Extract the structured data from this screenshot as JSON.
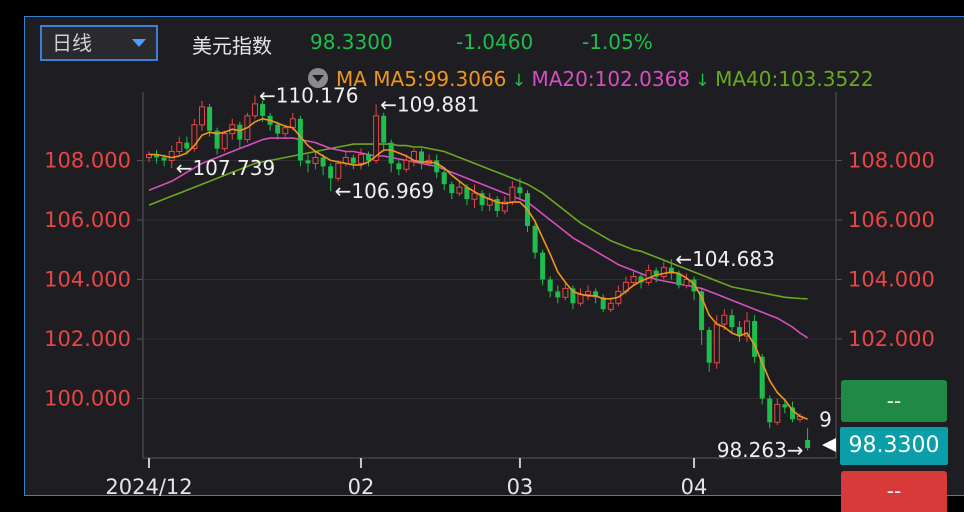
{
  "header": {
    "period": "日线",
    "name": "美元指数",
    "price": "98.3300",
    "change": "-1.0460",
    "change_pct": "-1.05%",
    "ma_label": "MA",
    "ma5": "MA5:99.3066",
    "ma20": "MA20:102.0368",
    "ma40": "MA40:103.3522"
  },
  "side": {
    "buy_label": "--",
    "current_price": "98.3300",
    "sell_label": "--"
  },
  "colors": {
    "up": "#e84545",
    "down": "#1fbd4e",
    "ma5": "#f0951e",
    "ma20": "#d64fc0",
    "ma40": "#6aa820",
    "axis_text": "#e84545",
    "up_text": "#1fbd4e"
  },
  "chart_data": {
    "type": "candlestick",
    "ylim": [
      98.0,
      110.3
    ],
    "yticks": [
      "100.000",
      "102.000",
      "104.000",
      "106.000",
      "108.000"
    ],
    "ytick_values": [
      100,
      102,
      104,
      106,
      108
    ],
    "xticks": [
      "2024/12",
      "02",
      "03",
      "04"
    ],
    "xtick_index": [
      0,
      28,
      49,
      72
    ],
    "annotations": [
      {
        "text": "←110.176",
        "index": 14,
        "value": 110.176
      },
      {
        "text": "←109.881",
        "index": 30,
        "value": 109.881
      },
      {
        "text": "←107.739",
        "index": 3,
        "value": 107.739
      },
      {
        "text": "←106.969",
        "index": 24,
        "value": 106.969
      },
      {
        "text": "←104.683",
        "index": 69,
        "value": 104.683
      },
      {
        "text": "98.263→",
        "index": 87,
        "value": 98.263
      },
      {
        "text": "9",
        "index": 88,
        "value": 99.3
      }
    ],
    "candles": [
      [
        108.1,
        108.2,
        107.95,
        108.3
      ],
      [
        108.2,
        108.1,
        107.9,
        108.35
      ],
      [
        108.1,
        108.0,
        107.8,
        108.2
      ],
      [
        108.0,
        108.3,
        107.74,
        108.5
      ],
      [
        108.3,
        108.6,
        108.2,
        108.8
      ],
      [
        108.6,
        108.4,
        108.2,
        108.8
      ],
      [
        108.4,
        109.2,
        108.3,
        109.4
      ],
      [
        109.2,
        109.8,
        109.0,
        110.0
      ],
      [
        109.8,
        109.0,
        108.8,
        109.9
      ],
      [
        109.0,
        108.4,
        108.2,
        109.1
      ],
      [
        108.4,
        108.9,
        108.3,
        109.0
      ],
      [
        108.9,
        109.2,
        108.7,
        109.4
      ],
      [
        109.2,
        108.7,
        108.4,
        109.3
      ],
      [
        108.7,
        109.5,
        108.6,
        109.6
      ],
      [
        109.5,
        109.9,
        109.4,
        110.18
      ],
      [
        109.9,
        109.5,
        109.3,
        110.0
      ],
      [
        109.5,
        109.2,
        109.0,
        109.6
      ],
      [
        109.2,
        108.9,
        108.7,
        109.3
      ],
      [
        108.9,
        109.1,
        108.8,
        109.2
      ],
      [
        109.1,
        109.4,
        109.0,
        109.6
      ],
      [
        109.4,
        108.0,
        107.8,
        109.5
      ],
      [
        108.0,
        107.9,
        107.6,
        108.2
      ],
      [
        107.9,
        108.1,
        107.7,
        108.3
      ],
      [
        108.1,
        107.8,
        107.5,
        108.2
      ],
      [
        107.8,
        107.4,
        106.97,
        107.9
      ],
      [
        107.4,
        107.9,
        107.3,
        108.0
      ],
      [
        107.9,
        108.1,
        107.8,
        108.3
      ],
      [
        108.1,
        107.9,
        107.7,
        108.2
      ],
      [
        107.9,
        108.2,
        107.7,
        108.4
      ],
      [
        108.2,
        108.0,
        107.8,
        108.3
      ],
      [
        108.0,
        109.5,
        107.9,
        109.88
      ],
      [
        109.5,
        108.6,
        108.3,
        109.6
      ],
      [
        108.6,
        107.9,
        107.6,
        108.7
      ],
      [
        107.9,
        107.7,
        107.5,
        108.0
      ],
      [
        107.7,
        108.0,
        107.6,
        108.2
      ],
      [
        108.0,
        108.3,
        107.8,
        108.4
      ],
      [
        108.3,
        107.9,
        107.7,
        108.4
      ],
      [
        107.9,
        108.0,
        107.8,
        108.2
      ],
      [
        108.0,
        107.6,
        107.4,
        108.2
      ],
      [
        107.6,
        107.2,
        107.0,
        107.7
      ],
      [
        107.2,
        106.9,
        106.7,
        107.3
      ],
      [
        106.9,
        107.1,
        106.8,
        107.3
      ],
      [
        107.1,
        106.7,
        106.5,
        107.2
      ],
      [
        106.7,
        106.9,
        106.4,
        107.2
      ],
      [
        106.9,
        106.5,
        106.3,
        107.0
      ],
      [
        106.5,
        106.7,
        106.3,
        106.9
      ],
      [
        106.7,
        106.3,
        106.1,
        106.8
      ],
      [
        106.3,
        106.6,
        106.2,
        106.8
      ],
      [
        106.6,
        107.1,
        106.5,
        107.3
      ],
      [
        107.1,
        106.9,
        106.7,
        107.4
      ],
      [
        106.9,
        105.8,
        105.6,
        107.0
      ],
      [
        105.8,
        104.9,
        104.7,
        105.9
      ],
      [
        104.9,
        104.0,
        103.8,
        105.0
      ],
      [
        104.0,
        103.6,
        103.4,
        104.1
      ],
      [
        103.6,
        103.4,
        103.2,
        103.8
      ],
      [
        103.4,
        103.7,
        103.3,
        103.9
      ],
      [
        103.7,
        103.2,
        103.0,
        103.8
      ],
      [
        103.2,
        103.5,
        103.1,
        103.7
      ],
      [
        103.5,
        103.6,
        103.3,
        103.8
      ],
      [
        103.6,
        103.4,
        103.2,
        103.7
      ],
      [
        103.4,
        103.0,
        102.9,
        103.5
      ],
      [
        103.0,
        103.2,
        102.9,
        103.4
      ],
      [
        103.2,
        103.6,
        103.1,
        103.8
      ],
      [
        103.6,
        103.9,
        103.5,
        104.1
      ],
      [
        103.9,
        104.1,
        103.8,
        104.3
      ],
      [
        104.1,
        103.9,
        103.7,
        104.2
      ],
      [
        103.9,
        104.3,
        103.8,
        104.5
      ],
      [
        104.3,
        104.1,
        103.9,
        104.4
      ],
      [
        104.1,
        104.4,
        104.0,
        104.6
      ],
      [
        104.4,
        104.2,
        104.0,
        104.68
      ],
      [
        104.2,
        103.8,
        103.7,
        104.3
      ],
      [
        103.8,
        104.0,
        103.7,
        104.2
      ],
      [
        104.0,
        103.6,
        103.3,
        104.1
      ],
      [
        103.6,
        102.3,
        101.8,
        103.7
      ],
      [
        102.3,
        101.2,
        100.9,
        102.4
      ],
      [
        101.2,
        102.5,
        101.0,
        102.8
      ],
      [
        102.5,
        102.8,
        102.3,
        103.0
      ],
      [
        102.8,
        102.4,
        102.2,
        103.0
      ],
      [
        102.4,
        102.1,
        101.9,
        102.6
      ],
      [
        102.1,
        102.6,
        101.9,
        102.9
      ],
      [
        102.6,
        101.4,
        101.2,
        102.8
      ],
      [
        101.4,
        100.0,
        99.8,
        101.5
      ],
      [
        100.0,
        99.2,
        99.0,
        100.1
      ],
      [
        99.2,
        99.8,
        99.1,
        100.0
      ],
      [
        99.8,
        99.7,
        99.5,
        100.0
      ],
      [
        99.7,
        99.3,
        99.2,
        99.9
      ],
      [
        99.3,
        99.4,
        99.2,
        99.5
      ],
      [
        98.6,
        98.33,
        98.26,
        99.0
      ]
    ],
    "ma5": [
      108.2,
      108.2,
      108.15,
      108.1,
      108.15,
      108.25,
      108.5,
      108.85,
      108.95,
      108.9,
      108.95,
      109.05,
      109.0,
      109.1,
      109.3,
      109.4,
      109.35,
      109.25,
      109.15,
      109.1,
      108.8,
      108.5,
      108.3,
      108.15,
      108.0,
      107.95,
      107.9,
      107.85,
      107.85,
      107.95,
      108.15,
      108.35,
      108.35,
      108.25,
      108.15,
      108.0,
      107.95,
      107.95,
      107.9,
      107.75,
      107.5,
      107.3,
      107.1,
      106.95,
      106.8,
      106.7,
      106.6,
      106.55,
      106.6,
      106.6,
      106.35,
      105.95,
      105.4,
      104.85,
      104.25,
      103.9,
      103.6,
      103.5,
      103.45,
      103.45,
      103.35,
      103.35,
      103.4,
      103.6,
      103.8,
      103.95,
      104.05,
      104.15,
      104.2,
      104.25,
      104.2,
      104.05,
      103.85,
      103.4,
      102.8,
      102.5,
      102.4,
      102.2,
      102.1,
      102.2,
      101.8,
      101.2,
      100.6,
      100.2,
      99.95,
      99.6,
      99.4,
      99.3
    ],
    "ma20": [
      107.0,
      107.1,
      107.2,
      107.3,
      107.45,
      107.6,
      107.75,
      107.9,
      108.0,
      108.1,
      108.2,
      108.3,
      108.4,
      108.5,
      108.6,
      108.7,
      108.75,
      108.75,
      108.75,
      108.75,
      108.7,
      108.65,
      108.6,
      108.5,
      108.4,
      108.35,
      108.3,
      108.3,
      108.25,
      108.2,
      108.15,
      108.15,
      108.1,
      108.05,
      108.0,
      107.95,
      107.9,
      107.85,
      107.8,
      107.7,
      107.6,
      107.5,
      107.4,
      107.3,
      107.2,
      107.1,
      107.0,
      106.9,
      106.8,
      106.7,
      106.6,
      106.4,
      106.2,
      106.0,
      105.8,
      105.6,
      105.4,
      105.25,
      105.1,
      104.95,
      104.8,
      104.65,
      104.5,
      104.4,
      104.3,
      104.2,
      104.1,
      104.0,
      103.95,
      103.9,
      103.85,
      103.8,
      103.75,
      103.7,
      103.6,
      103.5,
      103.4,
      103.3,
      103.2,
      103.1,
      103.0,
      102.9,
      102.8,
      102.7,
      102.55,
      102.4,
      102.2,
      102.04
    ],
    "ma40": [
      106.5,
      106.6,
      106.7,
      106.8,
      106.9,
      107.0,
      107.1,
      107.2,
      107.3,
      107.4,
      107.5,
      107.6,
      107.7,
      107.8,
      107.9,
      107.95,
      108.0,
      108.05,
      108.1,
      108.15,
      108.2,
      108.25,
      108.3,
      108.35,
      108.4,
      108.45,
      108.5,
      108.55,
      108.55,
      108.55,
      108.55,
      108.55,
      108.55,
      108.5,
      108.5,
      108.45,
      108.45,
      108.4,
      108.35,
      108.3,
      108.2,
      108.1,
      108.0,
      107.9,
      107.8,
      107.7,
      107.6,
      107.5,
      107.4,
      107.3,
      107.2,
      107.05,
      106.9,
      106.7,
      106.5,
      106.3,
      106.1,
      105.9,
      105.75,
      105.6,
      105.45,
      105.3,
      105.2,
      105.1,
      105.0,
      104.95,
      104.85,
      104.75,
      104.65,
      104.55,
      104.45,
      104.35,
      104.25,
      104.15,
      104.05,
      103.95,
      103.85,
      103.75,
      103.7,
      103.65,
      103.6,
      103.55,
      103.5,
      103.45,
      103.4,
      103.38,
      103.36,
      103.35
    ]
  }
}
